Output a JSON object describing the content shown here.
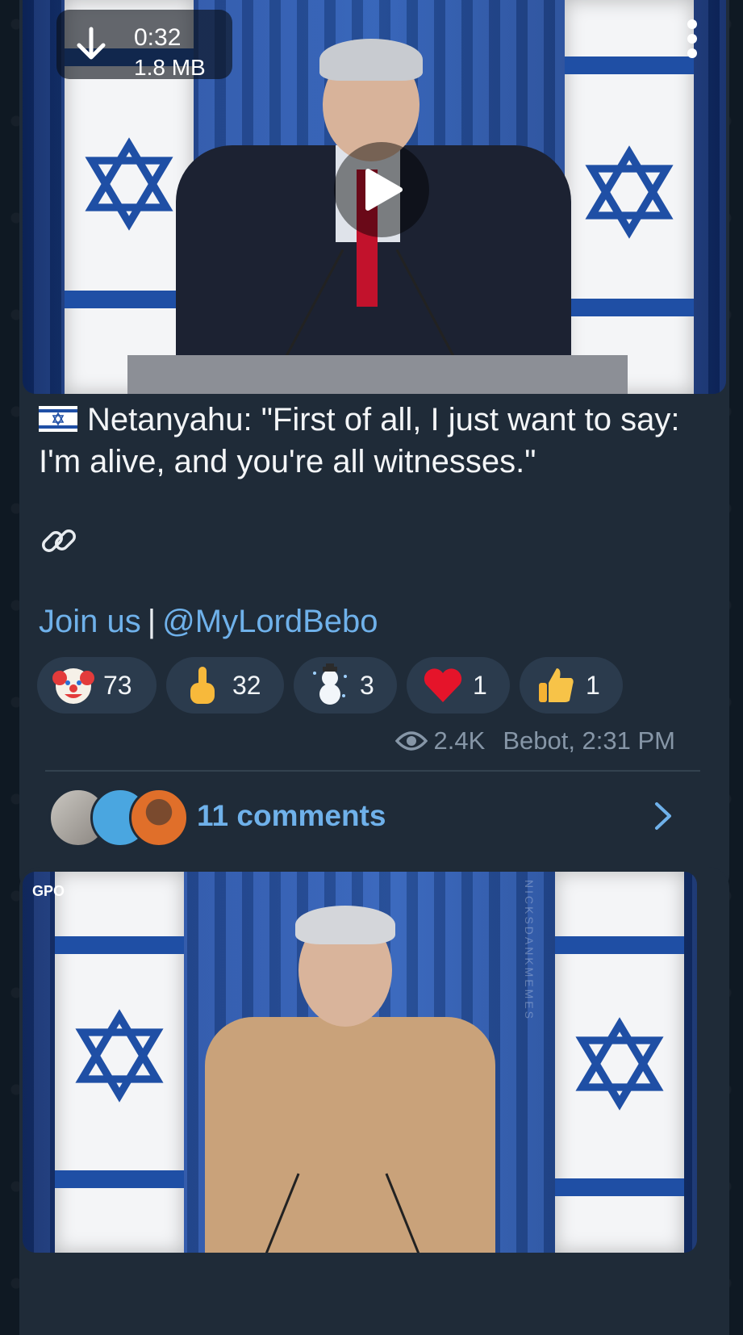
{
  "post1": {
    "video": {
      "duration": "0:32",
      "size": "1.8 MB"
    },
    "caption": "Netanyahu: \"First of all, I just want to say: I'm alive, and you're all witnesses.\"",
    "join": {
      "join_text": "Join us",
      "separator": "|",
      "handle": "@MyLordBebo"
    },
    "reactions": [
      {
        "emoji": "clown",
        "count": "73"
      },
      {
        "emoji": "middle-finger",
        "count": "32"
      },
      {
        "emoji": "snowman",
        "count": "3"
      },
      {
        "emoji": "heart",
        "count": "1"
      },
      {
        "emoji": "thumbs-up",
        "count": "1"
      }
    ],
    "views": "2.4K",
    "author_time": "Bebot, 2:31 PM",
    "comments": "11 comments"
  },
  "post2": {
    "logo_text": "GPO",
    "watermark": "NICKSDANKMEMES"
  },
  "colors": {
    "bubble": "#1f2b38",
    "link": "#6fb1ea",
    "meta": "#8696a7",
    "reaction_bg": "#2b3b4d"
  }
}
